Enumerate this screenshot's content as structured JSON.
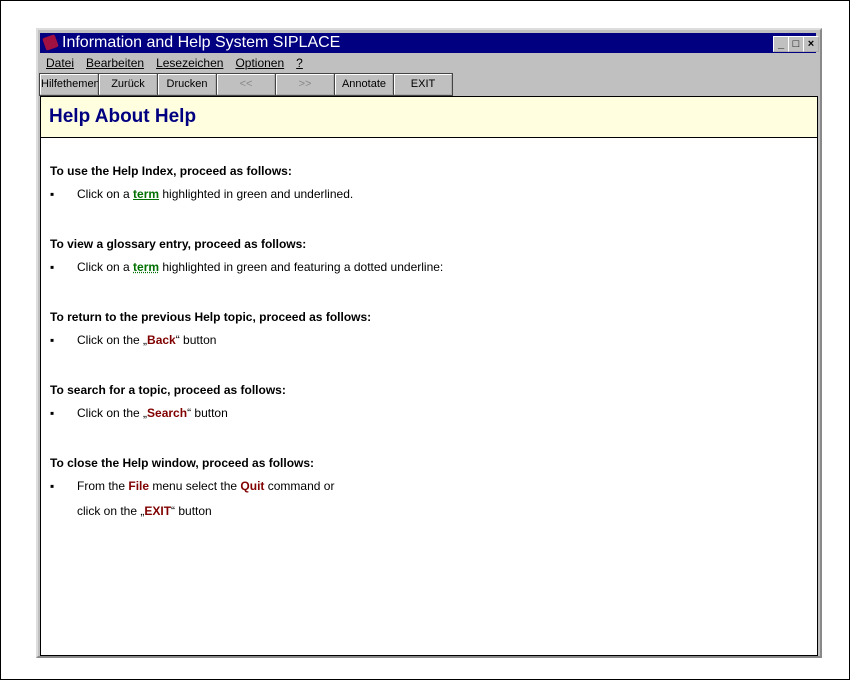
{
  "window": {
    "title": "Information and Help System SIPLACE",
    "min": "_",
    "max": "□",
    "close": "×"
  },
  "menu": [
    "Datei",
    "Bearbeiten",
    "Lesezeichen",
    "Optionen",
    "?"
  ],
  "toolbar": [
    "Hilfethemen",
    "Zurück",
    "Drucken",
    "<<",
    ">>",
    "Annotate",
    "EXIT"
  ],
  "header": "Help About Help",
  "sections": [
    {
      "heading": "To use the Help Index, proceed as follows:",
      "pre": "Click on a ",
      "em": "term",
      "post": " highlighted in green and underlined."
    },
    {
      "heading": "To view a glossary entry, proceed as follows:",
      "pre": "Click on a ",
      "em": "term",
      "post": " highlighted in green and featuring a dotted underline:"
    },
    {
      "heading": "To return to the previous Help topic, proceed as follows:",
      "pre": "Click on the „",
      "em": "Back",
      "post": "“ button"
    },
    {
      "heading": "To search for a topic, proceed as follows:",
      "pre": "Click on the „",
      "em": "Search",
      "post": "“ button"
    },
    {
      "heading": "To close the Help window, proceed as follows:",
      "pre": "From the ",
      "em": "File",
      "mid": " menu select the ",
      "em2": "Quit",
      "post": " command or",
      "line2pre": "click on the „",
      "line2em": "EXIT",
      "line2post": "“ button"
    }
  ],
  "bullet": "▪"
}
